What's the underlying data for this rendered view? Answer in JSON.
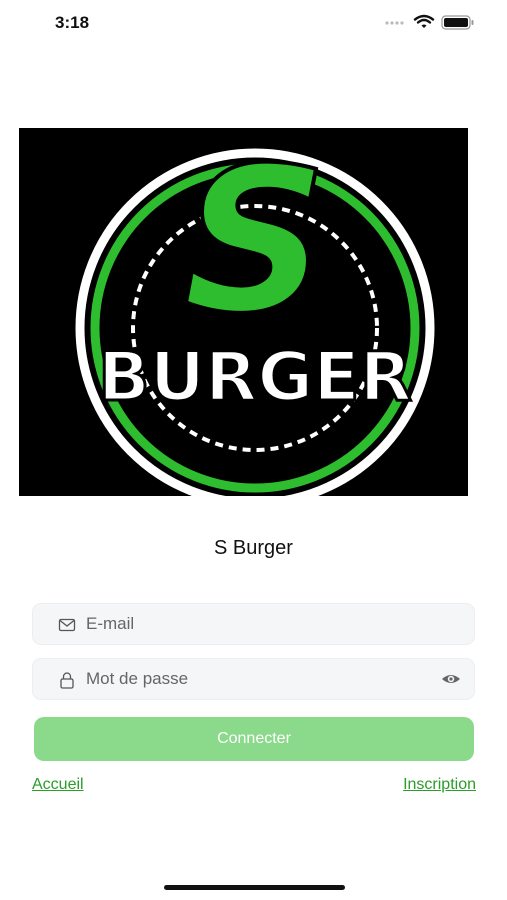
{
  "status_bar": {
    "time": "3:18",
    "icons": [
      "signal-icon",
      "wifi-icon",
      "battery-icon"
    ]
  },
  "logo": {
    "letter": "S",
    "wordmark": "BURGER",
    "colors": {
      "background": "#000000",
      "green": "#2ebd2e",
      "ring": "#ffffff"
    }
  },
  "app_title": "S Burger",
  "form": {
    "email": {
      "placeholder": "E-mail",
      "value": "",
      "icon": "mail-icon"
    },
    "password": {
      "placeholder": "Mot de passe",
      "value": "",
      "icon": "lock-icon",
      "toggle_icon": "eye-icon"
    },
    "submit_label": "Connecter"
  },
  "links": {
    "home": "Accueil",
    "signup": "Inscription"
  },
  "colors": {
    "accent": "#2a9d2a",
    "button": "#8bd98a"
  }
}
